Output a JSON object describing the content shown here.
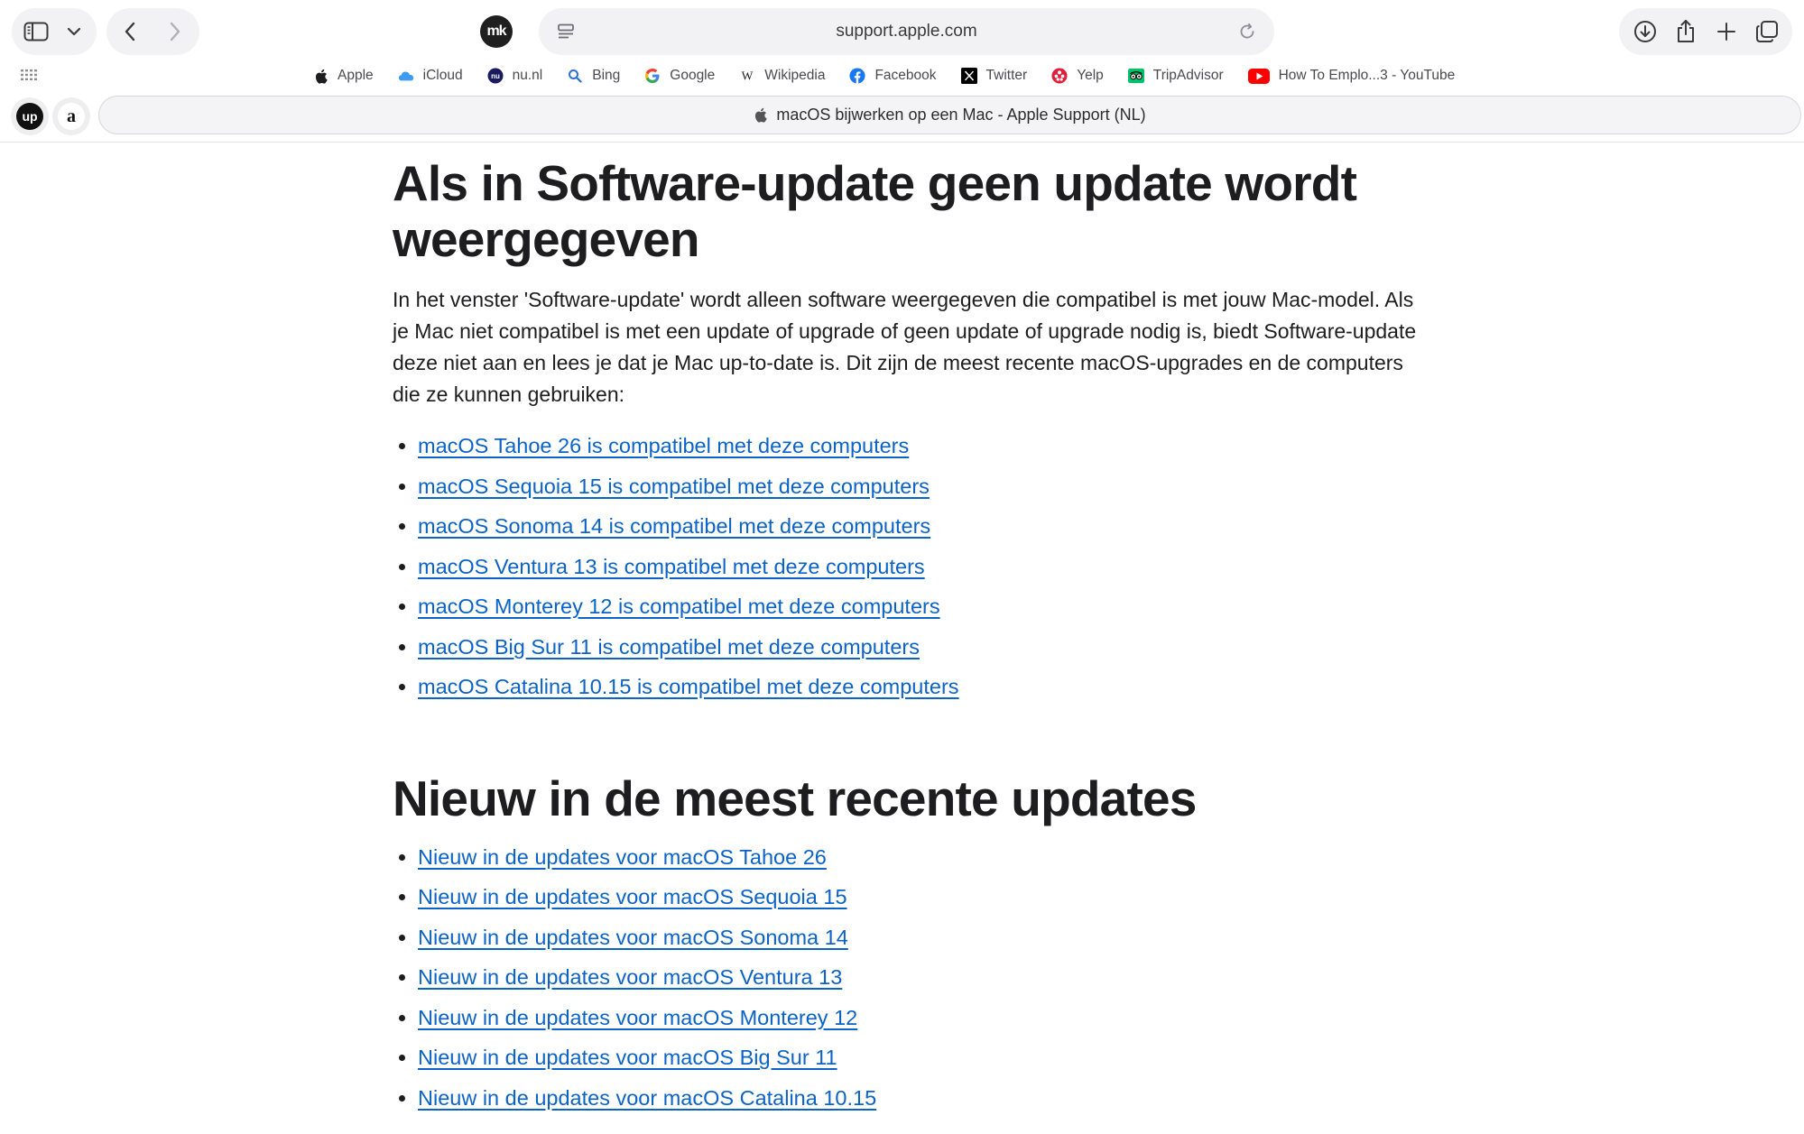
{
  "toolbar": {
    "address_url": "support.apple.com",
    "extension_mk_label": "mk"
  },
  "favorites": [
    {
      "label": "Apple",
      "icon": "apple-icon"
    },
    {
      "label": "iCloud",
      "icon": "icloud-icon"
    },
    {
      "label": "nu.nl",
      "icon": "nunl-icon"
    },
    {
      "label": "Bing",
      "icon": "bing-icon"
    },
    {
      "label": "Google",
      "icon": "google-icon"
    },
    {
      "label": "Wikipedia",
      "icon": "wikipedia-icon"
    },
    {
      "label": "Facebook",
      "icon": "facebook-icon"
    },
    {
      "label": "Twitter",
      "icon": "twitter-x-icon"
    },
    {
      "label": "Yelp",
      "icon": "yelp-icon"
    },
    {
      "label": "TripAdvisor",
      "icon": "tripadvisor-icon"
    },
    {
      "label": "How To Emplo...3 - YouTube",
      "icon": "youtube-icon"
    }
  ],
  "tabs": {
    "extension_up_label": "up",
    "extension_amazon_label": "a",
    "active_title": "macOS bijwerken op een Mac - Apple Support (NL)"
  },
  "content": {
    "heading1": "Als in Software-update geen update wordt weergegeven",
    "paragraph": "In het venster 'Software-update' wordt alleen software weergegeven die compatibel is met jouw Mac-model. Als je Mac niet compatibel is met een update of upgrade of geen update of upgrade nodig is, biedt Software-update deze niet aan en lees je dat je Mac up-to-date is. Dit zijn de meest recente macOS-upgrades en de computers die ze kunnen gebruiken:",
    "compat_links": [
      "macOS Tahoe 26 is compatibel met deze computers",
      "macOS Sequoia 15 is compatibel met deze computers",
      "macOS Sonoma 14 is compatibel met deze computers",
      "macOS Ventura 13 is compatibel met deze computers",
      "macOS Monterey 12 is compatibel met deze computers",
      "macOS Big Sur 11 is compatibel met deze computers",
      "macOS Catalina 10.15 is compatibel met deze computers"
    ],
    "heading2": "Nieuw in de meest recente updates",
    "new_links": [
      "Nieuw in de updates voor macOS Tahoe 26",
      "Nieuw in de updates voor macOS Sequoia 15",
      "Nieuw in de updates voor macOS Sonoma 14",
      "Nieuw in de updates voor macOS Ventura 13",
      "Nieuw in de updates voor macOS Monterey 12",
      "Nieuw in de updates voor macOS Big Sur 11",
      "Nieuw in de updates voor macOS Catalina 10.15"
    ]
  },
  "colors": {
    "link": "#0b63c8",
    "text": "#1d1d1f"
  }
}
